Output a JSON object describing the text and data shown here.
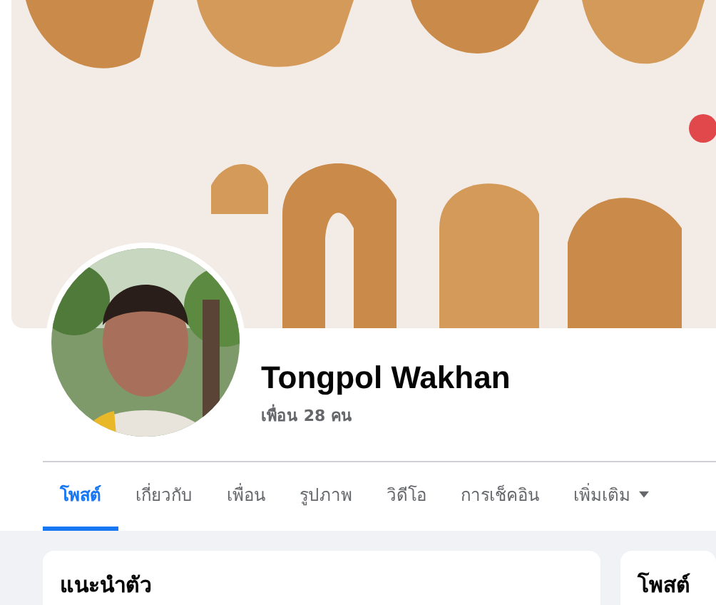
{
  "profile": {
    "name": "Tongpol Wakhan",
    "friends": "เพื่อน 28 คน"
  },
  "tabs": [
    {
      "label": "โพสต์",
      "selected": true,
      "kind": "link"
    },
    {
      "label": "เกี่ยวกับ",
      "selected": false,
      "kind": "link"
    },
    {
      "label": "เพื่อน",
      "selected": false,
      "kind": "link"
    },
    {
      "label": "รูปภาพ",
      "selected": false,
      "kind": "link"
    },
    {
      "label": "วิดีโอ",
      "selected": false,
      "kind": "link"
    },
    {
      "label": "การเช็คอิน",
      "selected": false,
      "kind": "link"
    },
    {
      "label": "เพิ่มเติม",
      "selected": false,
      "kind": "menu"
    }
  ],
  "cards": [
    {
      "title": "แนะนำตัว"
    },
    {
      "title": "โพสต์"
    }
  ]
}
